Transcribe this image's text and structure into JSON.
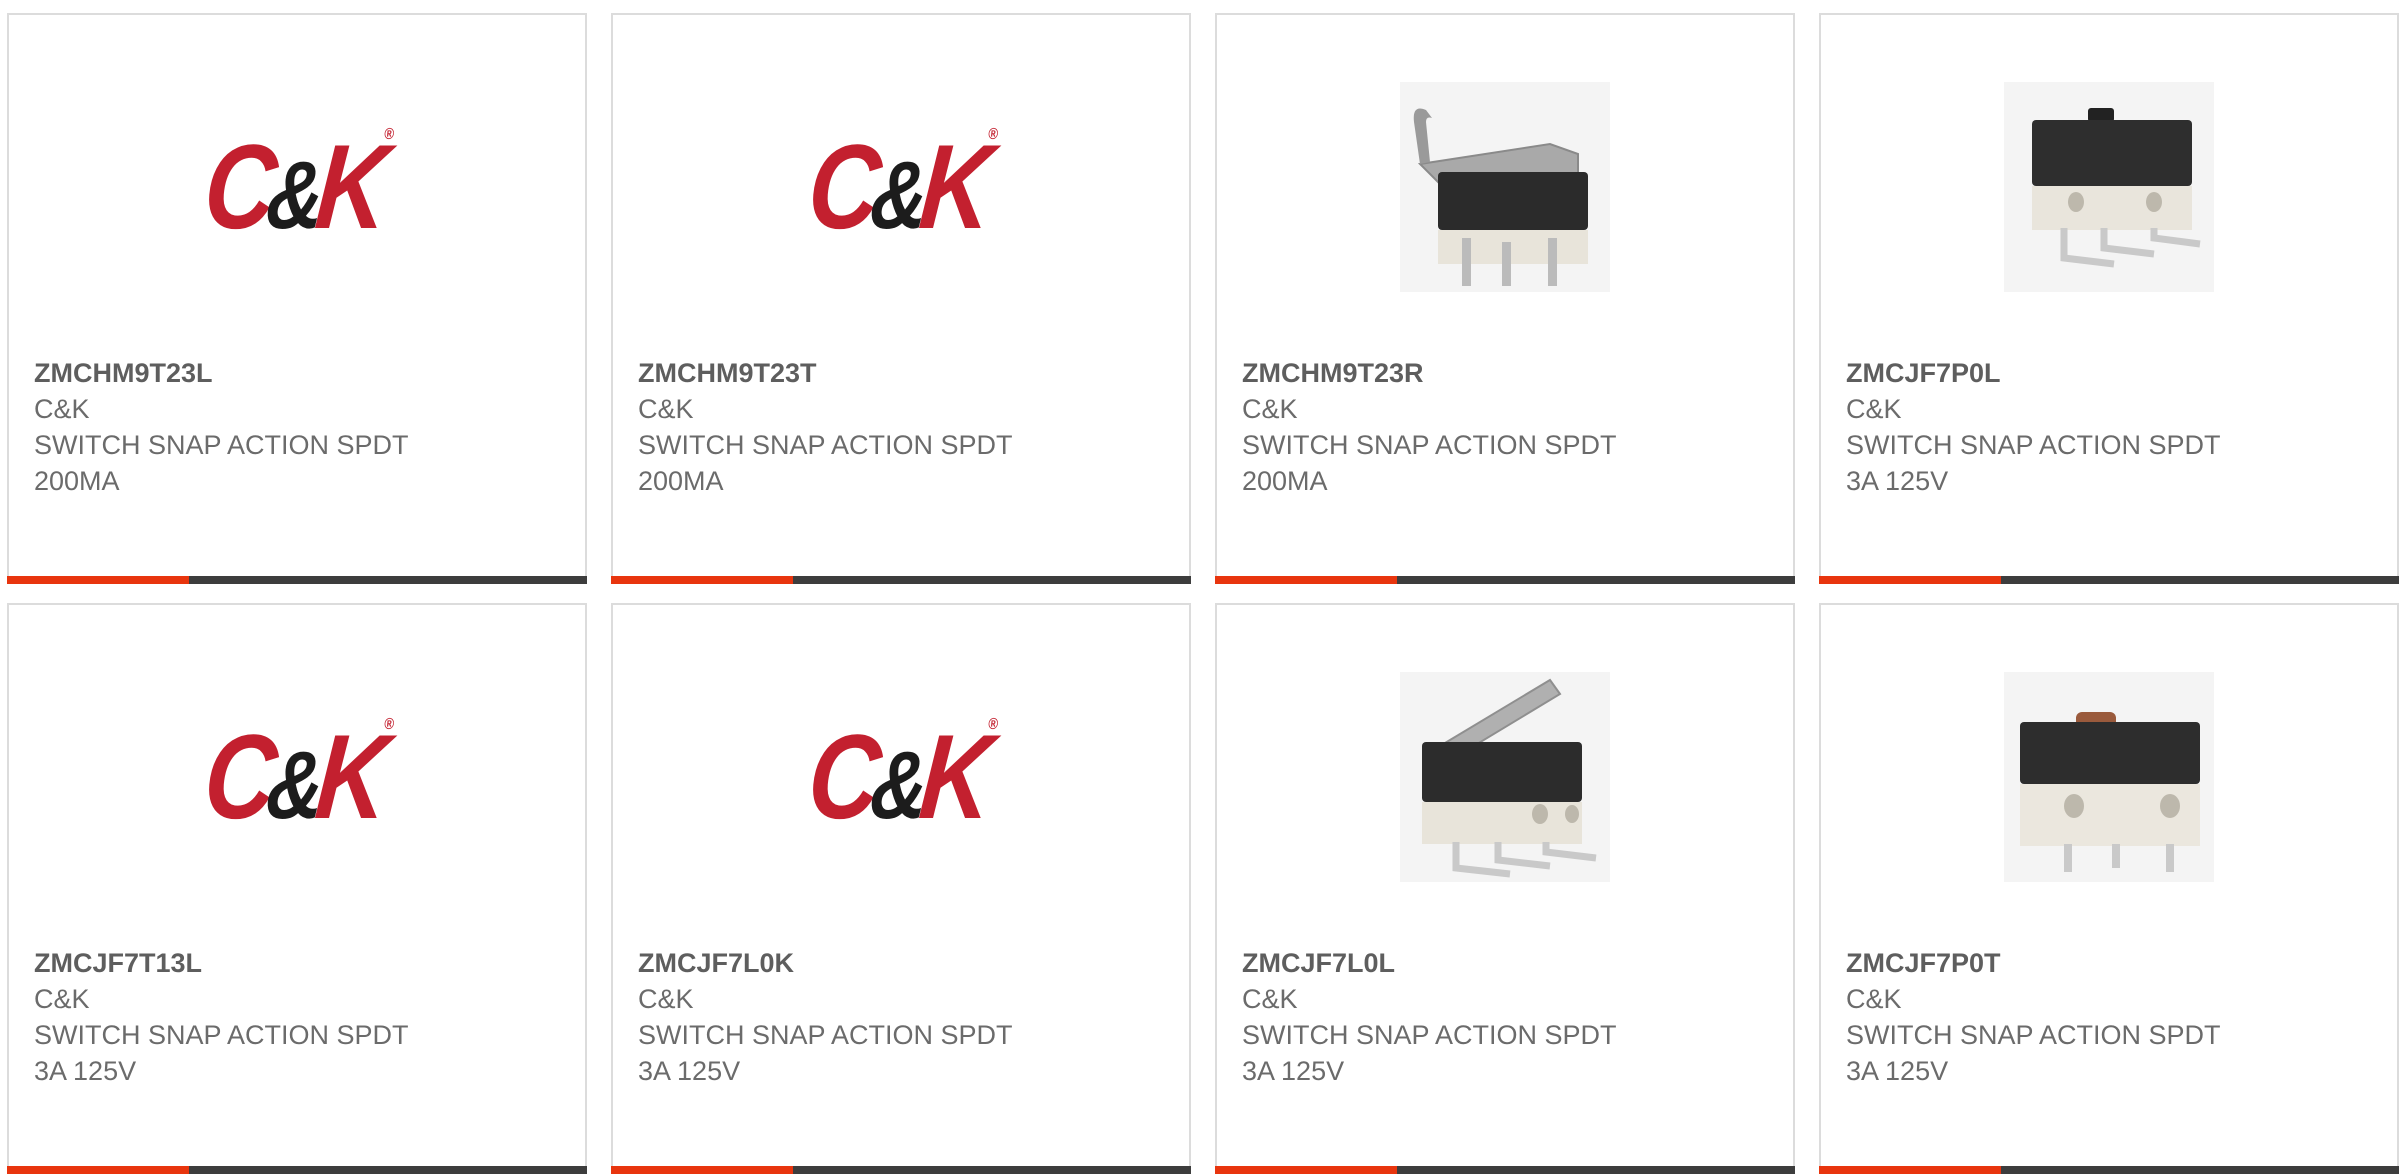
{
  "products": [
    {
      "part_number": "ZMCHM9T23L",
      "manufacturer": "C&K",
      "desc_line1": "SWITCH SNAP ACTION SPDT",
      "desc_line2": "200MA",
      "image": "ck-logo"
    },
    {
      "part_number": "ZMCHM9T23T",
      "manufacturer": "C&K",
      "desc_line1": "SWITCH SNAP ACTION SPDT",
      "desc_line2": "200MA",
      "image": "ck-logo"
    },
    {
      "part_number": "ZMCHM9T23R",
      "manufacturer": "C&K",
      "desc_line1": "SWITCH SNAP ACTION SPDT",
      "desc_line2": "200MA",
      "image": "microswitch-roller-lever-photo"
    },
    {
      "part_number": "ZMCJF7P0L",
      "manufacturer": "C&K",
      "desc_line1": "SWITCH SNAP ACTION SPDT",
      "desc_line2": "3A 125V",
      "image": "microswitch-pin-plunger-photo"
    },
    {
      "part_number": "ZMCJF7T13L",
      "manufacturer": "C&K",
      "desc_line1": "SWITCH SNAP ACTION SPDT",
      "desc_line2": "3A 125V",
      "image": "ck-logo"
    },
    {
      "part_number": "ZMCJF7L0K",
      "manufacturer": "C&K",
      "desc_line1": "SWITCH SNAP ACTION SPDT",
      "desc_line2": "3A 125V",
      "image": "ck-logo"
    },
    {
      "part_number": "ZMCJF7L0L",
      "manufacturer": "C&K",
      "desc_line1": "SWITCH SNAP ACTION SPDT",
      "desc_line2": "3A 125V",
      "image": "microswitch-flat-lever-photo"
    },
    {
      "part_number": "ZMCJF7P0T",
      "manufacturer": "C&K",
      "desc_line1": "SWITCH SNAP ACTION SPDT",
      "desc_line2": "3A 125V",
      "image": "microswitch-pin-plunger-photo"
    }
  ],
  "logo": {
    "left": "C",
    "amp": "&",
    "right": "K",
    "tm": "®"
  },
  "colors": {
    "accent": "#e8350e",
    "bar": "#3d3d3d",
    "brand_red": "#c3202f",
    "text": "#6b6b6b",
    "border": "#dcdcdc"
  }
}
